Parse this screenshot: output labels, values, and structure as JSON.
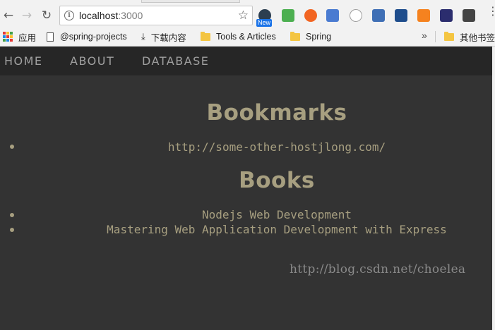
{
  "browser": {
    "url_host": "localhost",
    "url_port": ":3000",
    "new_badge": "New",
    "bookmarks_bar": {
      "apps_label": "应用",
      "items": [
        {
          "label": "@spring-projects",
          "icon": "page-icon"
        },
        {
          "label": "下载内容",
          "icon": "download-icon"
        },
        {
          "label": "Tools & Articles",
          "icon": "folder-icon"
        },
        {
          "label": "Spring",
          "icon": "folder-icon"
        }
      ],
      "overflow_label": "»",
      "other_bookmarks": "其他书签"
    },
    "extension_colors": [
      "#2c3e50",
      "#4caf50",
      "#f26522",
      "#4a7bd1",
      "#9e9e9e",
      "#3f6fb5",
      "#1e4d8c",
      "#f5821f",
      "#2b2d6e",
      "#444444"
    ]
  },
  "navbar": {
    "links": [
      "HOME",
      "ABOUT",
      "DATABASE"
    ]
  },
  "main": {
    "bookmarks_title": "Bookmarks",
    "bookmarks": [
      "http://some-other-hostjlong.com/"
    ],
    "books_title": "Books",
    "books": [
      "Nodejs Web Development",
      "Mastering Web Application Development with Express"
    ]
  },
  "watermark": "http://blog.csdn.net/choelea",
  "colors": {
    "page_bg": "#333333",
    "navbar_bg": "#262626",
    "accent_text": "#a79f80",
    "nav_text": "#a0a0a0"
  }
}
